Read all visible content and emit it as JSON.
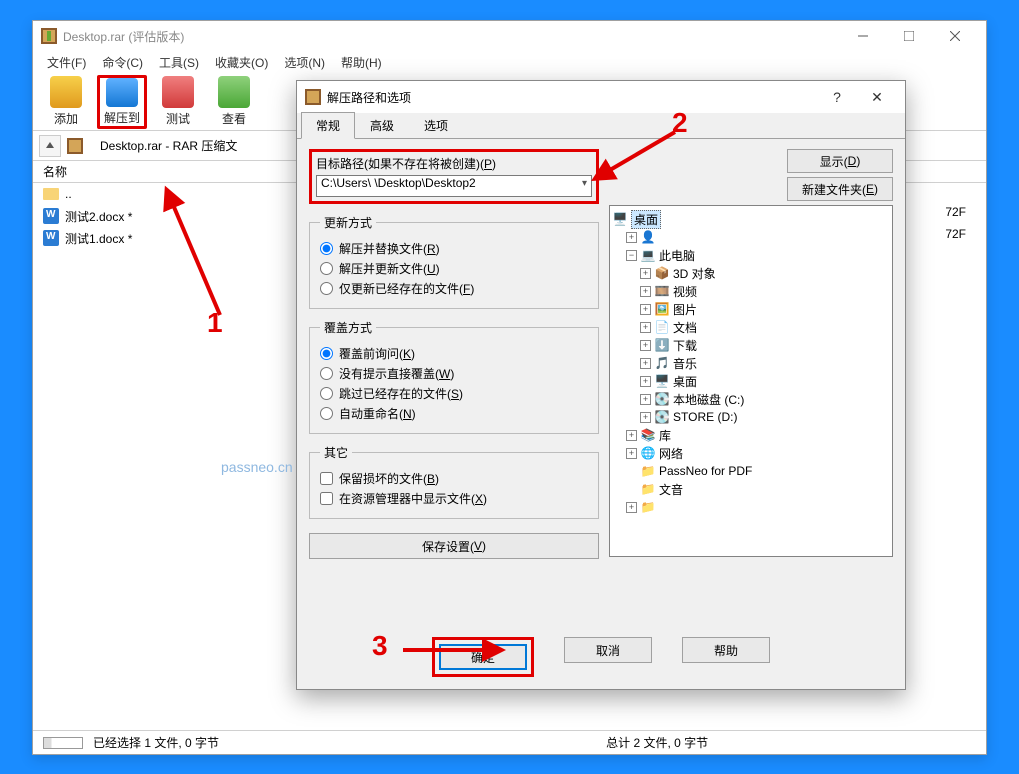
{
  "main": {
    "title": "Desktop.rar (评估版本)",
    "menu": [
      "文件(F)",
      "命令(C)",
      "工具(S)",
      "收藏夹(O)",
      "选项(N)",
      "帮助(H)"
    ],
    "toolbar": {
      "add": "添加",
      "extract": "解压到",
      "test": "测试",
      "view": "查看"
    },
    "path": "Desktop.rar - RAR 压缩文",
    "col_name": "名称",
    "rows": {
      "up": "..",
      "file1": "测试2.docx *",
      "file2": "测试1.docx *"
    },
    "size1": "72F",
    "size2": "72F",
    "status_sel": "已经选择 1 文件, 0 字节",
    "status_tot": "总计 2 文件, 0 字节"
  },
  "dialog": {
    "title": "解压路径和选项",
    "tabs": {
      "t1": "常规",
      "t2": "高级",
      "t3": "选项"
    },
    "path_label": "目标路径(如果不存在将被创建)(",
    "path_label_u": "P",
    "path_value": "C:\\Users\\         \\Desktop\\Desktop2",
    "show_btn": "显示(",
    "show_u": "D",
    "newfolder_btn": "新建文件夹(",
    "newfolder_u": "E",
    "grp_update": "更新方式",
    "u1": "解压并替换文件(",
    "u1u": "R",
    "u2": "解压并更新文件(",
    "u2u": "U",
    "u3": "仅更新已经存在的文件(",
    "u3u": "F",
    "grp_over": "覆盖方式",
    "o1": "覆盖前询问(",
    "o1u": "K",
    "o2": "没有提示直接覆盖(",
    "o2u": "W",
    "o3": "跳过已经存在的文件(",
    "o3u": "S",
    "o4": "自动重命名(",
    "o4u": "N",
    "grp_misc": "其它",
    "m1": "保留损坏的文件(",
    "m1u": "B",
    "m2": "在资源管理器中显示文件(",
    "m2u": "X",
    "save_btn": "保存设置(",
    "save_u": "V",
    "ok": "确定",
    "cancel": "取消",
    "help": "帮助",
    "tree": {
      "desktop": "桌面",
      "user": "",
      "thispc": "此电脑",
      "3d": "3D 对象",
      "video": "视频",
      "pics": "图片",
      "docs": "文档",
      "dl": "下载",
      "music": "音乐",
      "desk2": "桌面",
      "cdisk": "本地磁盘 (C:)",
      "ddisk": "STORE (D:)",
      "lib": "库",
      "net": "网络",
      "pn": "PassNeo for PDF",
      "wy": "文音"
    }
  },
  "annotations": {
    "n1": "1",
    "n2": "2",
    "n3": "3"
  },
  "watermark": "passneo.cn"
}
